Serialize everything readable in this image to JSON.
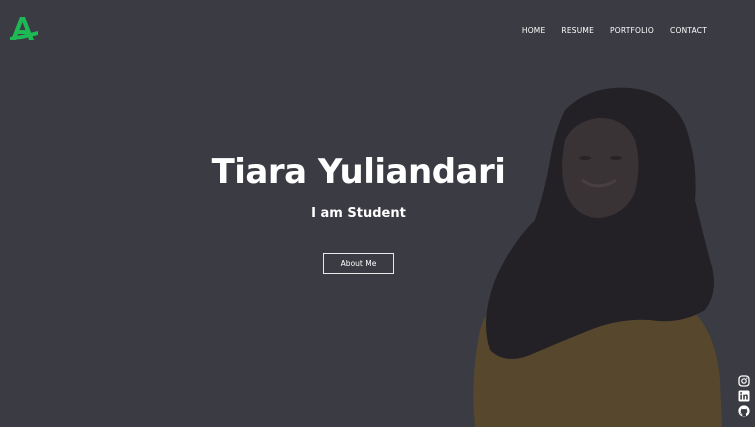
{
  "brand": {
    "logo_icon": "stylized-letter-a-logo-icon",
    "logo_color": "#1db954"
  },
  "nav": {
    "items": [
      {
        "label": "HOME"
      },
      {
        "label": "RESUME"
      },
      {
        "label": "PORTFOLIO"
      },
      {
        "label": "CONTACT"
      }
    ]
  },
  "hero": {
    "name": "Tiara Yuliandari",
    "tagline": "I am Student",
    "cta_label": "About Me",
    "background_color": "#3b3b43"
  },
  "social": {
    "icons": [
      "instagram-icon",
      "linkedin-icon",
      "github-icon"
    ]
  }
}
